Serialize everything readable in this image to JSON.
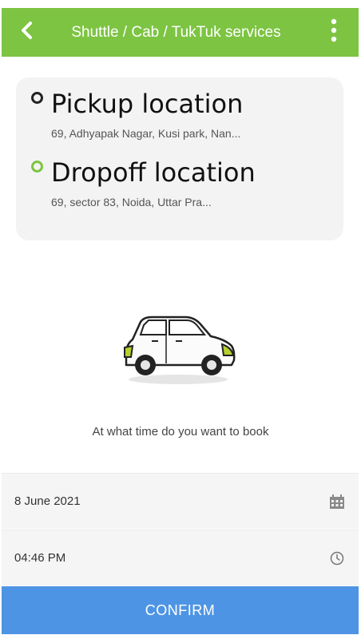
{
  "header": {
    "title": "Shuttle / Cab / TukTuk services",
    "back_icon": "back-chevron-icon",
    "menu_icon": "more-vertical-icon"
  },
  "locations": {
    "pickup": {
      "title": "Pickup location",
      "address": "69, Adhyapak Nagar, Kusi park, Nan..."
    },
    "dropoff": {
      "title": "Dropoff location",
      "address": "69, sector 83, Noida, Uttar Pra..."
    }
  },
  "illustration": {
    "icon": "car-icon"
  },
  "prompt": "At what time do you want to book",
  "booking": {
    "date": {
      "value": "8 June 2021",
      "icon": "calendar-icon"
    },
    "time": {
      "value": "04:46 PM",
      "icon": "clock-icon"
    }
  },
  "confirm_label": "CONFIRM",
  "colors": {
    "primary": "#7dc442",
    "confirm": "#4e94e4"
  }
}
